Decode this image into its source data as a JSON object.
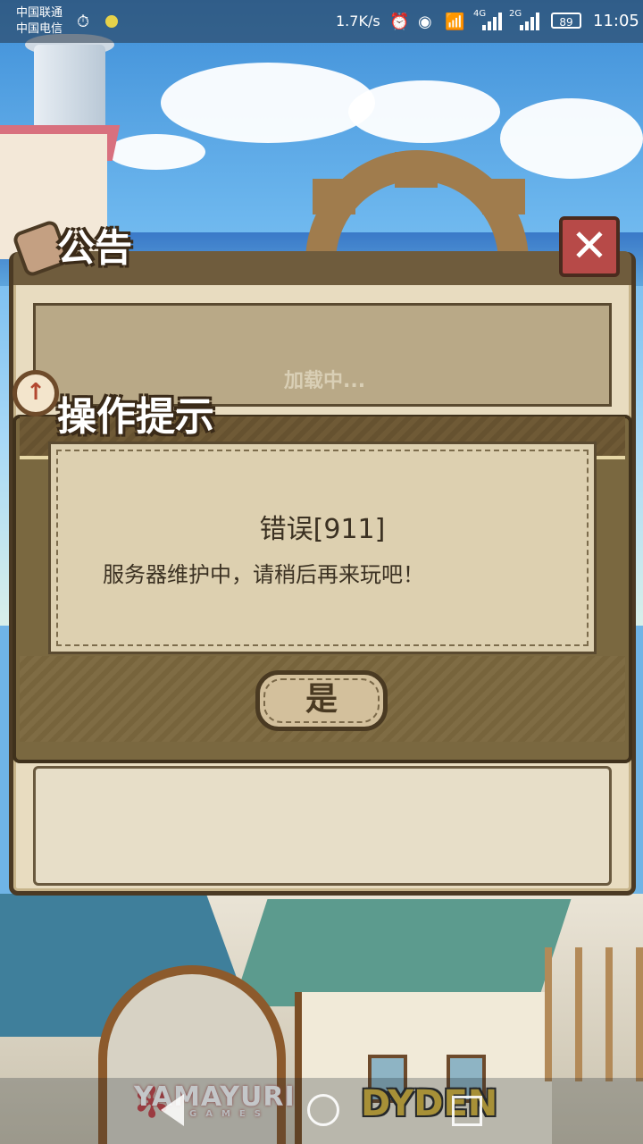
{
  "status_bar": {
    "carrier_1": "中国联通",
    "carrier_2": "中国电信",
    "net_speed": "1.7K/s",
    "net_type_1": "4G",
    "net_type_2": "2G",
    "battery": "89",
    "time": "11:05"
  },
  "notice_panel": {
    "title": "公告",
    "loading_text": "加载中...",
    "close_icon": "close-x-icon"
  },
  "dialog": {
    "title": "操作提示",
    "error_code": "错误[911]",
    "message": "服务器维护中，请稍后再来玩吧！",
    "confirm_label": "是"
  },
  "logos": {
    "left": "YAMAYURI",
    "left_sub": "GAMES",
    "right": "DYDEN"
  },
  "colors": {
    "close_button": "#b74a48",
    "panel_border": "#4b3a24",
    "paper": "#ddd0b0"
  }
}
